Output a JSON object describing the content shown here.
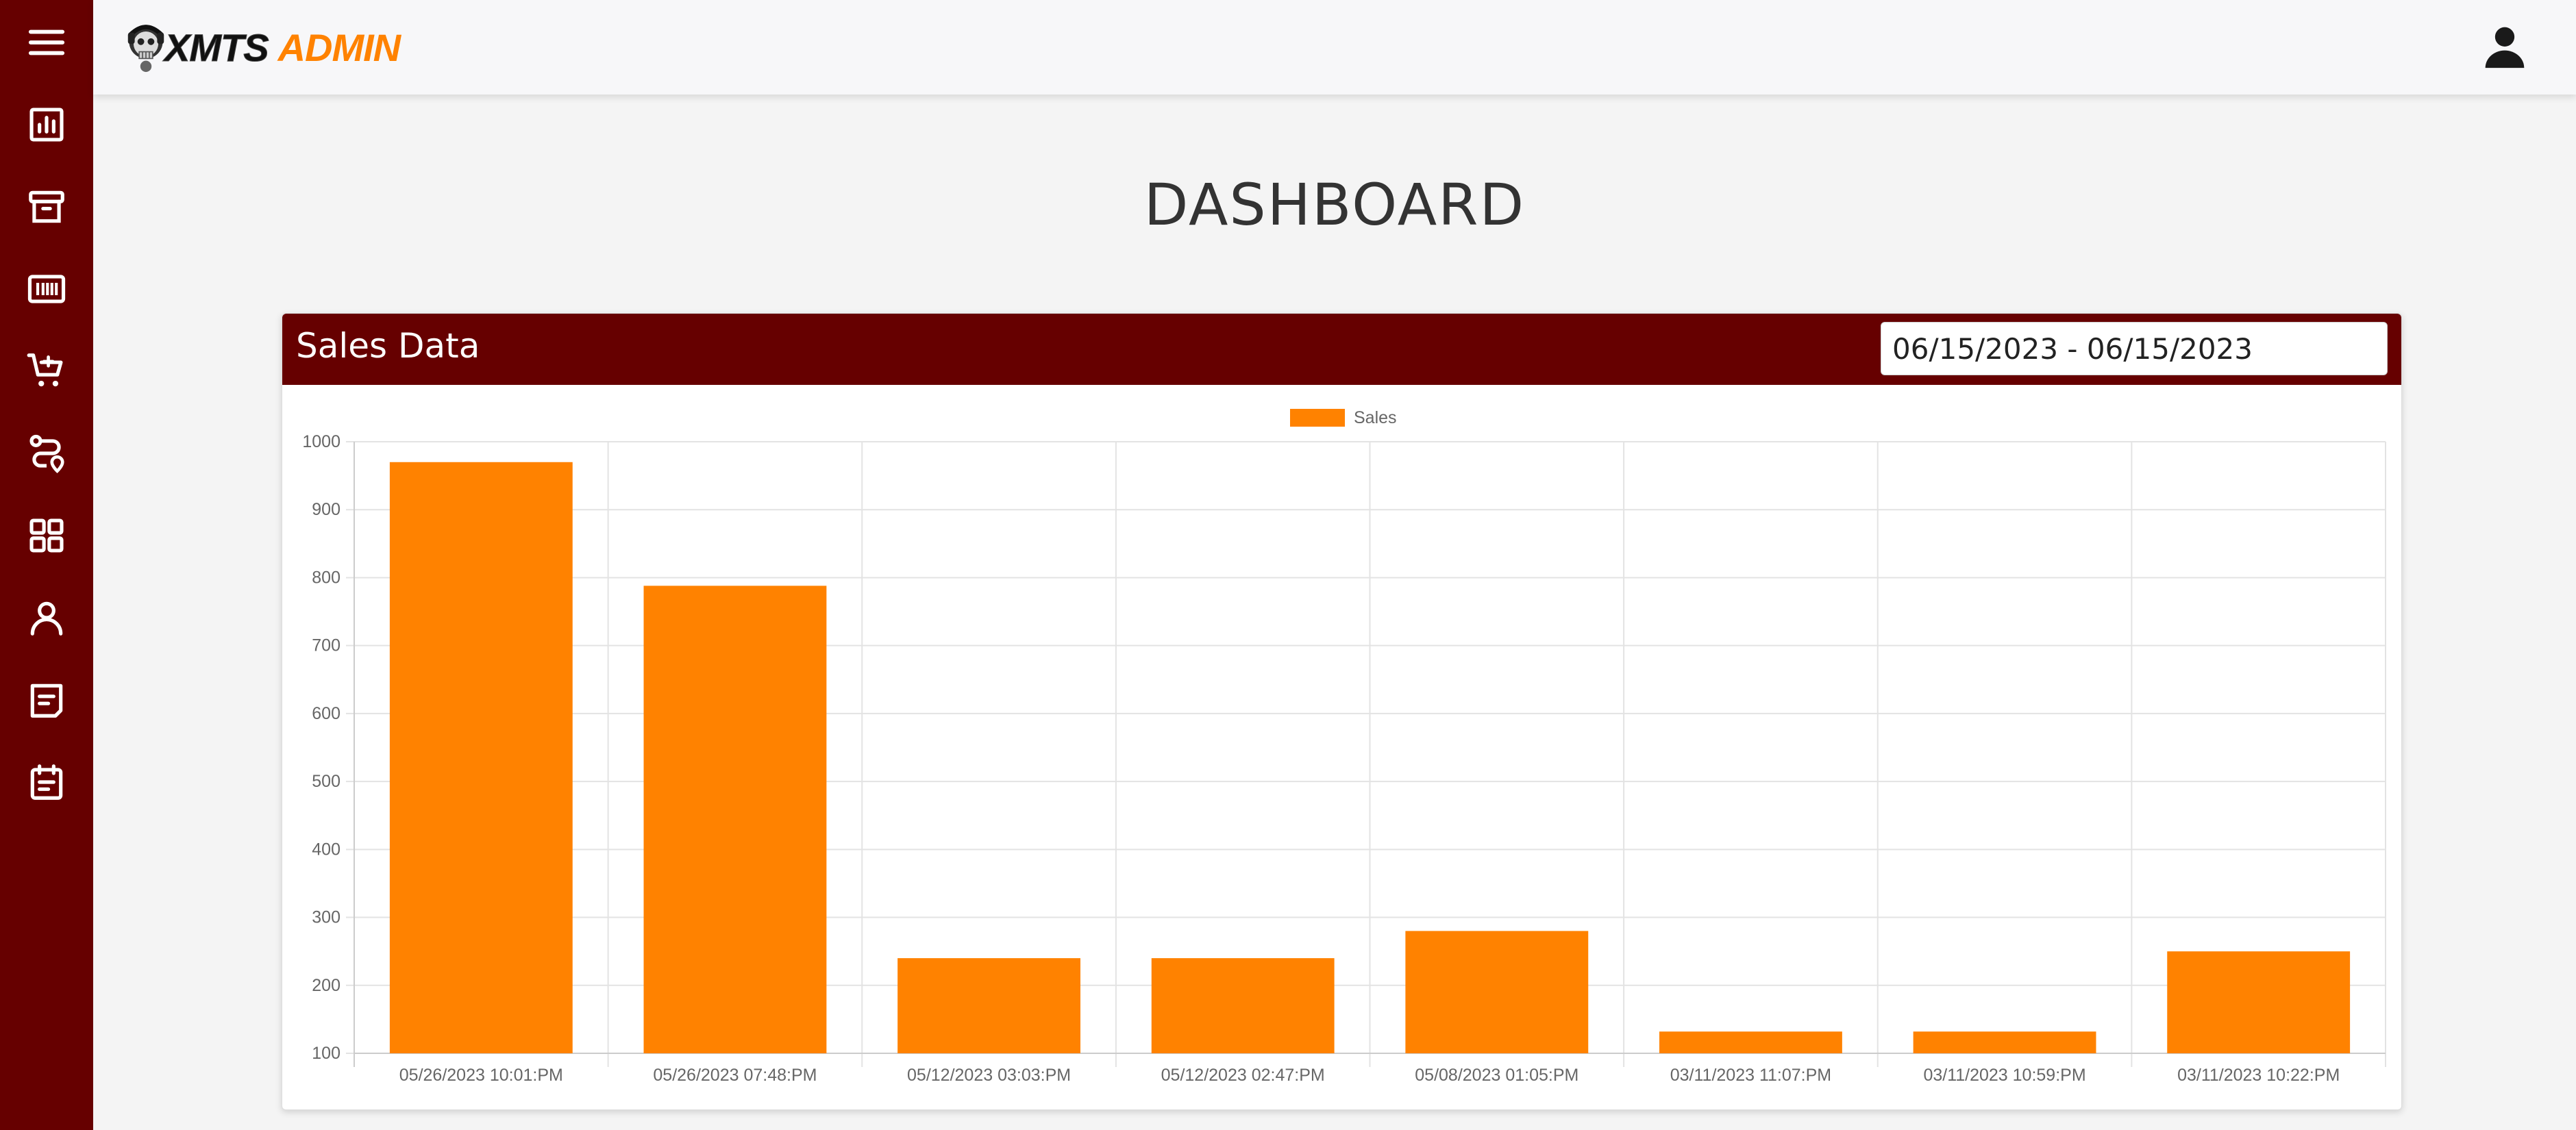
{
  "app": {
    "logo_text_dark": "XMTS",
    "logo_text_accent": "ADMIN"
  },
  "sidebar": {
    "items": [
      {
        "name": "menu-icon"
      },
      {
        "name": "chart-icon"
      },
      {
        "name": "archive-icon"
      },
      {
        "name": "barcode-icon"
      },
      {
        "name": "cart-add-icon"
      },
      {
        "name": "route-icon"
      },
      {
        "name": "grid-icon"
      },
      {
        "name": "user-icon"
      },
      {
        "name": "message-icon"
      },
      {
        "name": "clipboard-icon"
      }
    ]
  },
  "header": {
    "user_icon": "account-icon"
  },
  "page": {
    "title": "DASHBOARD"
  },
  "card": {
    "title": "Sales Data",
    "date_range_value": "06/15/2023 - 06/15/2023"
  },
  "colors": {
    "sidebar": "#660000",
    "accent": "#ff8200"
  },
  "chart_data": {
    "type": "bar",
    "categories": [
      "05/26/2023 10:01:PM",
      "05/26/2023 07:48:PM",
      "05/12/2023 03:03:PM",
      "05/12/2023 02:47:PM",
      "05/08/2023 01:05:PM",
      "03/11/2023 11:07:PM",
      "03/11/2023 10:59:PM",
      "03/11/2023 10:22:PM"
    ],
    "series": [
      {
        "name": "Sales",
        "values": [
          970,
          788,
          240,
          240,
          280,
          132,
          132,
          250
        ],
        "color": "#ff8200"
      }
    ],
    "ylim": [
      100,
      1000
    ],
    "yticks": [
      1000,
      900,
      800,
      700,
      600,
      500,
      400,
      300,
      200,
      100
    ],
    "grid": true,
    "legend": "top-center"
  }
}
